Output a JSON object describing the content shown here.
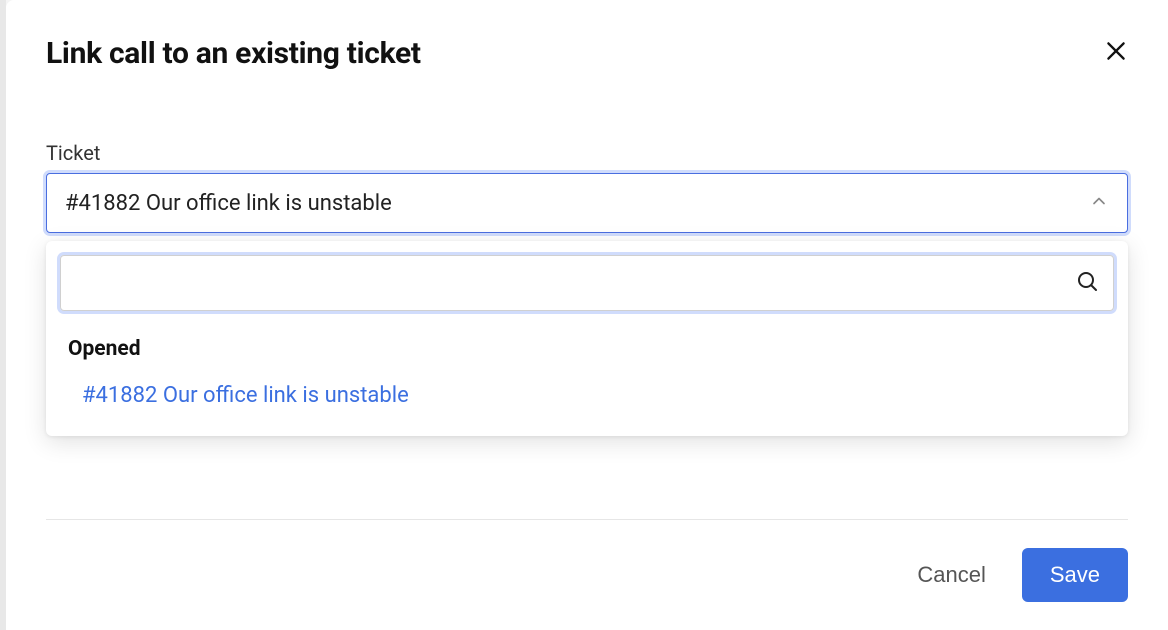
{
  "modal": {
    "title": "Link call to an existing ticket",
    "ticket_label": "Ticket",
    "selected_ticket": "#41882 Our office link is unstable",
    "search_value": "",
    "search_placeholder": "",
    "group_label": "Opened",
    "options": [
      {
        "label": "#41882 Our office link is unstable"
      }
    ],
    "cancel_label": "Cancel",
    "save_label": "Save"
  }
}
